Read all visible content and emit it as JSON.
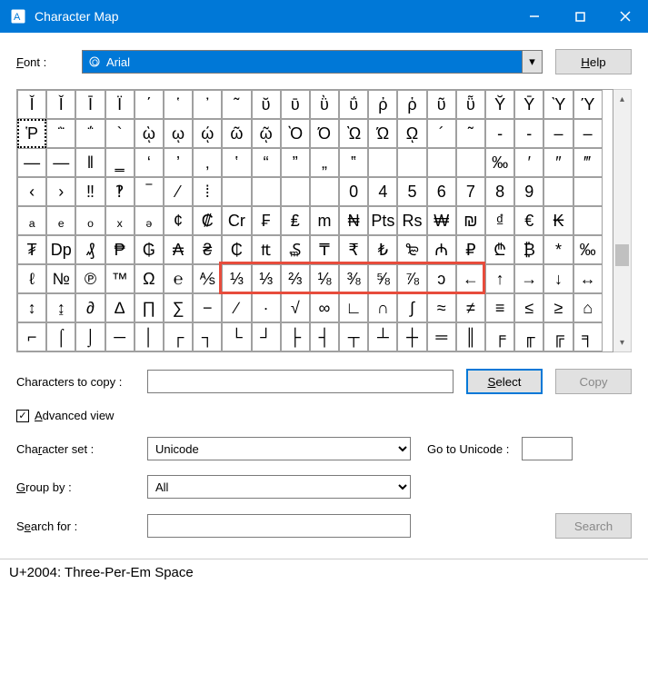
{
  "window": {
    "title": "Character Map"
  },
  "labels": {
    "font": "Font :",
    "chars_to_copy": "Characters to copy :",
    "advanced_view": "Advanced view",
    "charset": "Character set :",
    "groupby": "Group by :",
    "searchfor": "Search for :",
    "goto": "Go to Unicode :"
  },
  "font": {
    "selected": "Arial"
  },
  "buttons": {
    "help": "Help",
    "select": "Select",
    "copy": "Copy",
    "search": "Search"
  },
  "fields": {
    "chars_to_copy": "",
    "charset": "Unicode",
    "groupby": "All",
    "goto": "",
    "search": ""
  },
  "advanced_checked": true,
  "status": "U+2004: Three-Per-Em Space",
  "grid": [
    [
      "Ǐ",
      "Ǐ",
      "Ī",
      "Ϊ",
      "΄",
      "῾",
      "᾿",
      "῀",
      "ῠ",
      "ῡ",
      "ῢ",
      "ΰ",
      "ῤ",
      "ῥ",
      "ῦ",
      "ῧ",
      "Ῠ",
      "Ῡ",
      "Ὺ",
      "Ύ"
    ],
    [
      "Ῥ",
      "῭",
      "΅",
      "`",
      "ῲ",
      "ῳ",
      "ῴ",
      "ῶ",
      "ῷ",
      "Ὸ",
      "Ό",
      "Ὼ",
      "Ώ",
      "ῼ",
      "´",
      "῀",
      "‐",
      "-",
      "‒",
      "–"
    ],
    [
      "—",
      "―",
      "‖",
      "‗",
      "‘",
      "’",
      "‚",
      "‛",
      "“",
      "”",
      "„",
      "‟",
      "",
      "",
      "",
      "",
      "‰",
      "′",
      "″",
      "‴"
    ],
    [
      "‹",
      "›",
      "‼",
      "‽",
      "‾",
      "⁄",
      "⁞",
      "",
      "",
      "",
      "",
      "0",
      "4",
      "5",
      "6",
      "7",
      "8",
      "9",
      "",
      ""
    ],
    [
      "ₐ",
      "ₑ",
      "ₒ",
      "ₓ",
      "ₔ",
      "¢",
      "₡",
      "Cr",
      "₣",
      "₤",
      "m",
      "₦",
      "Pts",
      "Rs",
      "₩",
      "₪",
      "₫",
      "€",
      "₭",
      ""
    ],
    [
      "₮",
      "Dp",
      "₰",
      "₱",
      "₲",
      "₳",
      "₴",
      "₵",
      "₶",
      "₷",
      "₸",
      "₹",
      "₺",
      "₻",
      "₼",
      "₽",
      "₾",
      "₿",
      "*",
      "‰"
    ],
    [
      "ℓ",
      "№",
      "℗",
      "™",
      "Ω",
      "℮",
      "⅍",
      "⅓",
      "⅓",
      "⅔",
      "⅛",
      "⅜",
      "⅝",
      "⅞",
      "ↄ",
      "←",
      "↑",
      "→",
      "↓",
      "↔"
    ],
    [
      "↕",
      "↨",
      "∂",
      "∆",
      "∏",
      "∑",
      "−",
      "∕",
      "∙",
      "√",
      "∞",
      "∟",
      "∩",
      "∫",
      "≈",
      "≠",
      "≡",
      "≤",
      "≥",
      "⌂"
    ],
    [
      "⌐",
      "⌠",
      "⌡",
      "─",
      "│",
      "┌",
      "┐",
      "└",
      "┘",
      "├",
      "┤",
      "┬",
      "┴",
      "┼",
      "═",
      "║",
      "╒",
      "╓",
      "╔",
      "╕"
    ]
  ],
  "selected_cell": {
    "row": 1,
    "col": 0
  },
  "highlight": {
    "row": 6,
    "col_start": 7,
    "col_end": 15
  }
}
